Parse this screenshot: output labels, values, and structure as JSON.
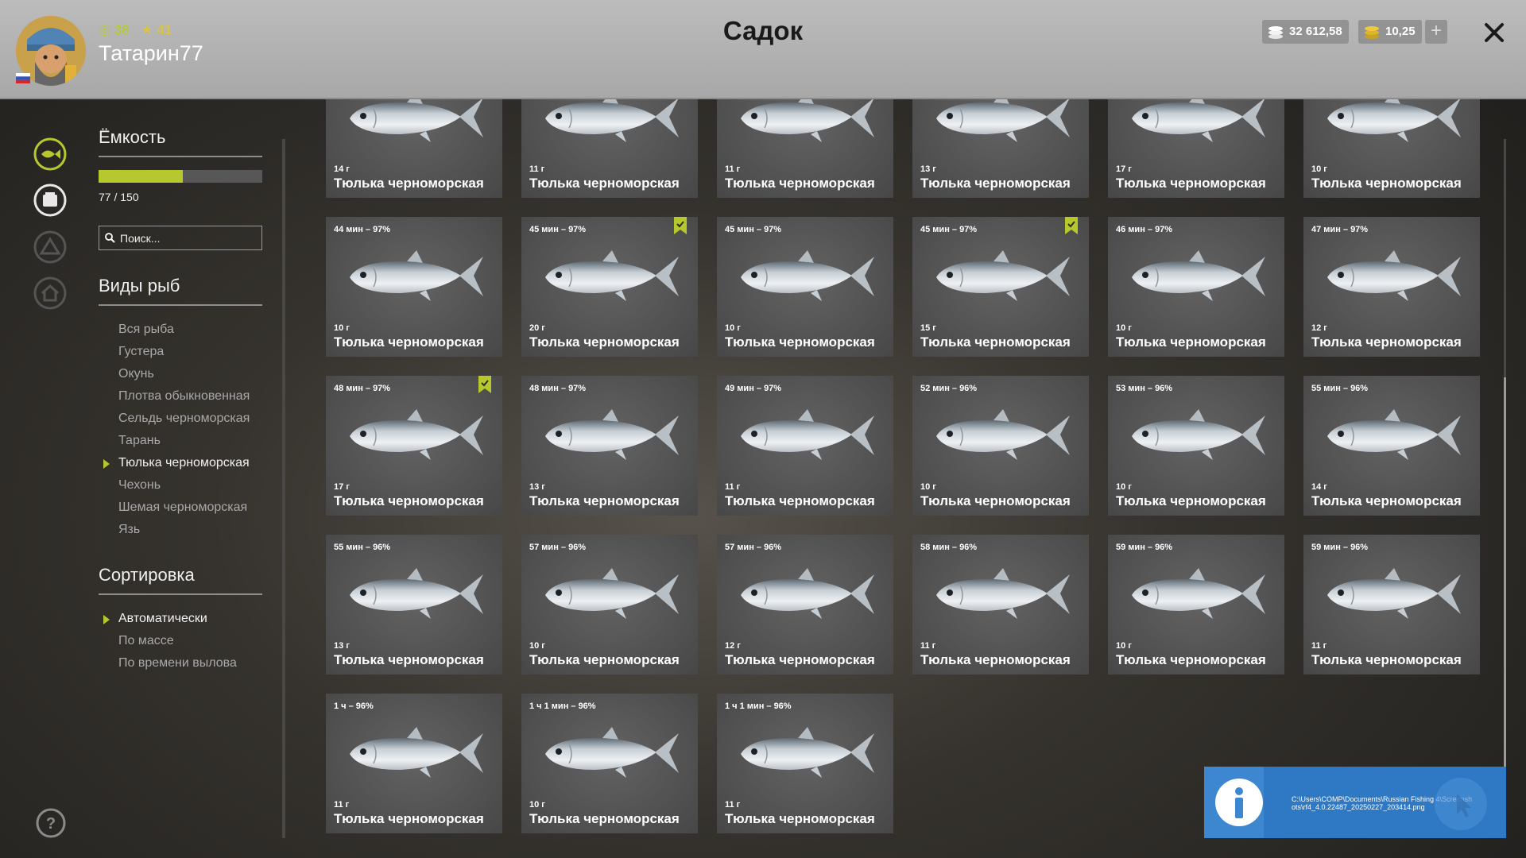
{
  "header": {
    "title": "Садок",
    "username": "Татарин77",
    "level": "38",
    "rank": "41",
    "silver": "32 612,58",
    "gold": "10,25"
  },
  "sidebar": {
    "capacity_title": "Ёмкость",
    "capacity_text": "77 / 150",
    "capacity_fraction": 0.513,
    "search_placeholder": "Поиск...",
    "species_title": "Виды рыб",
    "species": [
      {
        "label": "Вся рыба",
        "active": false
      },
      {
        "label": "Густера",
        "active": false
      },
      {
        "label": "Окунь",
        "active": false
      },
      {
        "label": "Плотва обыкновенная",
        "active": false
      },
      {
        "label": "Сельдь черноморская",
        "active": false
      },
      {
        "label": "Тарань",
        "active": false
      },
      {
        "label": "Тюлька черноморская",
        "active": true
      },
      {
        "label": "Чехонь",
        "active": false
      },
      {
        "label": "Шемая черноморская",
        "active": false
      },
      {
        "label": "Язь",
        "active": false
      }
    ],
    "sort_title": "Сортировка",
    "sort": [
      {
        "label": "Автоматически",
        "active": true
      },
      {
        "label": "По массе",
        "active": false
      },
      {
        "label": "По времени вылова",
        "active": false
      }
    ]
  },
  "colors": {
    "accent": "#b6c82e",
    "card": "#555555",
    "notification": "#2f78c3"
  },
  "fish_cards": [
    {
      "time": "",
      "weight": "14 г",
      "name": "Тюлька черноморская",
      "marked": false
    },
    {
      "time": "",
      "weight": "11 г",
      "name": "Тюлька черноморская",
      "marked": false
    },
    {
      "time": "",
      "weight": "11 г",
      "name": "Тюлька черноморская",
      "marked": false
    },
    {
      "time": "",
      "weight": "13 г",
      "name": "Тюлька черноморская",
      "marked": false
    },
    {
      "time": "",
      "weight": "17 г",
      "name": "Тюлька черноморская",
      "marked": false
    },
    {
      "time": "",
      "weight": "10 г",
      "name": "Тюлька черноморская",
      "marked": false
    },
    {
      "time": "44 мин – 97%",
      "weight": "10 г",
      "name": "Тюлька черноморская",
      "marked": false
    },
    {
      "time": "45 мин – 97%",
      "weight": "20 г",
      "name": "Тюлька черноморская",
      "marked": true
    },
    {
      "time": "45 мин – 97%",
      "weight": "10 г",
      "name": "Тюлька черноморская",
      "marked": false
    },
    {
      "time": "45 мин – 97%",
      "weight": "15 г",
      "name": "Тюлька черноморская",
      "marked": true
    },
    {
      "time": "46 мин – 97%",
      "weight": "10 г",
      "name": "Тюлька черноморская",
      "marked": false
    },
    {
      "time": "47 мин – 97%",
      "weight": "12 г",
      "name": "Тюлька черноморская",
      "marked": false
    },
    {
      "time": "48 мин – 97%",
      "weight": "17 г",
      "name": "Тюлька черноморская",
      "marked": true
    },
    {
      "time": "48 мин – 97%",
      "weight": "13 г",
      "name": "Тюлька черноморская",
      "marked": false
    },
    {
      "time": "49 мин – 97%",
      "weight": "11 г",
      "name": "Тюлька черноморская",
      "marked": false
    },
    {
      "time": "52 мин – 96%",
      "weight": "10 г",
      "name": "Тюлька черноморская",
      "marked": false
    },
    {
      "time": "53 мин – 96%",
      "weight": "10 г",
      "name": "Тюлька черноморская",
      "marked": false
    },
    {
      "time": "55 мин – 96%",
      "weight": "14 г",
      "name": "Тюлька черноморская",
      "marked": false
    },
    {
      "time": "55 мин – 96%",
      "weight": "13 г",
      "name": "Тюлька черноморская",
      "marked": false
    },
    {
      "time": "57 мин – 96%",
      "weight": "10 г",
      "name": "Тюлька черноморская",
      "marked": false
    },
    {
      "time": "57 мин – 96%",
      "weight": "12 г",
      "name": "Тюлька черноморская",
      "marked": false
    },
    {
      "time": "58 мин – 96%",
      "weight": "11 г",
      "name": "Тюлька черноморская",
      "marked": false
    },
    {
      "time": "59 мин – 96%",
      "weight": "10 г",
      "name": "Тюлька черноморская",
      "marked": false
    },
    {
      "time": "59 мин – 96%",
      "weight": "11 г",
      "name": "Тюлька черноморская",
      "marked": false
    },
    {
      "time": "1 ч – 96%",
      "weight": "11 г",
      "name": "Тюлька черноморская",
      "marked": false
    },
    {
      "time": "1 ч 1 мин – 96%",
      "weight": "10 г",
      "name": "Тюлька черноморская",
      "marked": false
    },
    {
      "time": "1 ч 1 мин – 96%",
      "weight": "11 г",
      "name": "Тюлька черноморская",
      "marked": false
    }
  ],
  "notification": {
    "text": "C:\\Users\\COMP\\Documents\\Russian Fishing 4\\Screenshots\\rf4_4.0.22487_20250227_203414.png"
  }
}
